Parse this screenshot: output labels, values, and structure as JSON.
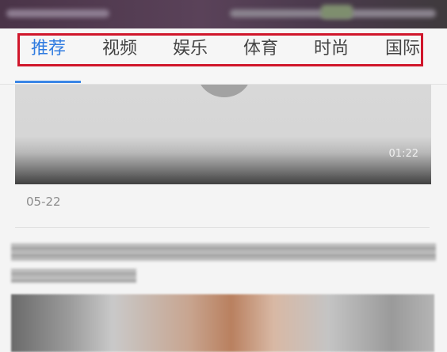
{
  "tabs": [
    {
      "label": "推荐",
      "active": true
    },
    {
      "label": "视频",
      "active": false
    },
    {
      "label": "娱乐",
      "active": false
    },
    {
      "label": "体育",
      "active": false
    },
    {
      "label": "时尚",
      "active": false
    },
    {
      "label": "国际",
      "active": false
    }
  ],
  "video": {
    "duration": "01:22",
    "date": "05-22"
  },
  "colors": {
    "accent": "#2f7be0",
    "highlight": "#d0162b"
  }
}
